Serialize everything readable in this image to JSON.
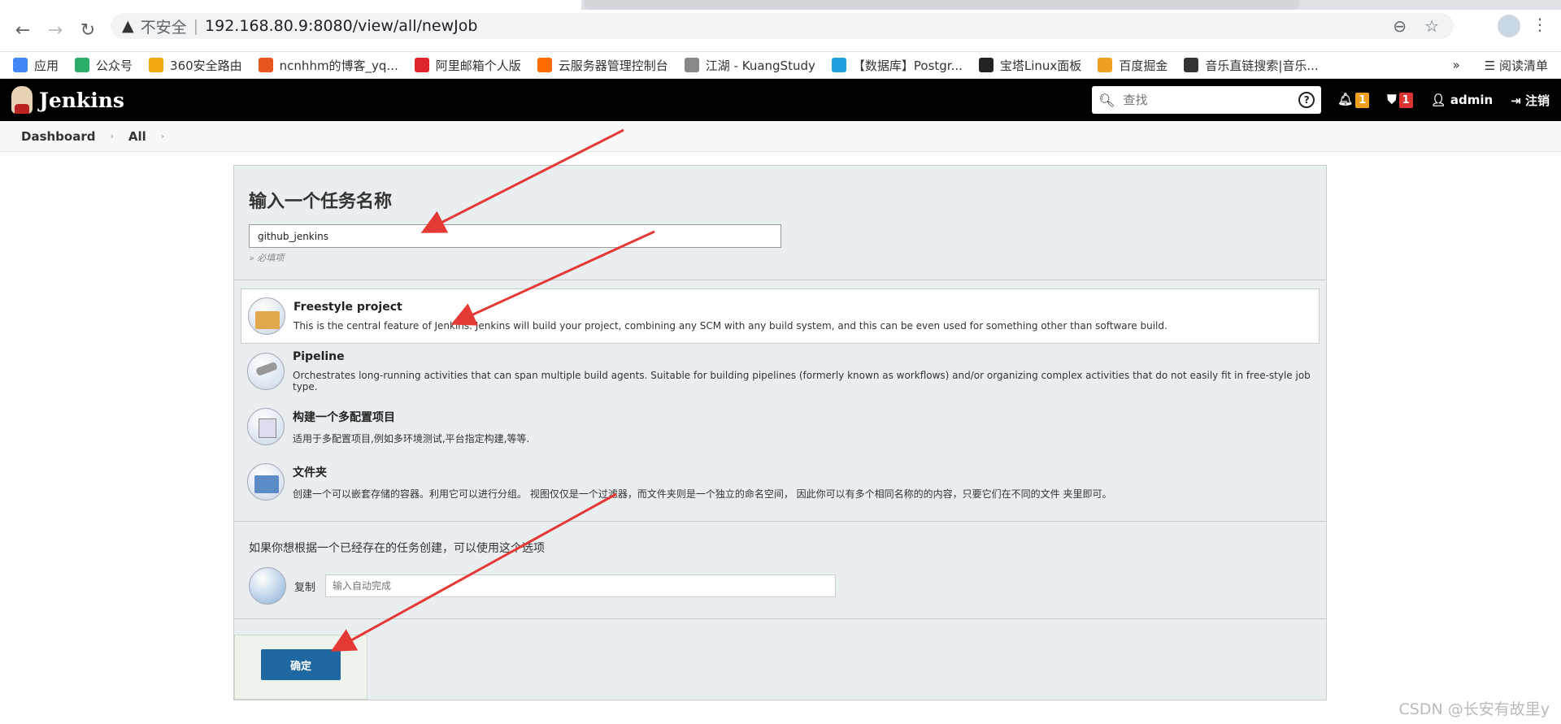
{
  "browser": {
    "insecure_label": "不安全",
    "url": "192.168.80.9:8080/view/all/newJob"
  },
  "bookmarks": [
    {
      "label": "应用",
      "color": "#4285f4"
    },
    {
      "label": "公众号",
      "color": "#2aae67"
    },
    {
      "label": "360安全路由",
      "color": "#f3a712"
    },
    {
      "label": "ncnhhm的博客_yq...",
      "color": "#e8541e"
    },
    {
      "label": "阿里邮箱个人版",
      "color": "#e0242c"
    },
    {
      "label": "云服务器管理控制台",
      "color": "#ff6a00"
    },
    {
      "label": "江湖 - KuangStudy",
      "color": "#888888"
    },
    {
      "label": "【数据库】Postgr...",
      "color": "#20a0e0"
    },
    {
      "label": "宝塔Linux面板",
      "color": "#222222"
    },
    {
      "label": "百度掘金",
      "color": "#f0a020"
    },
    {
      "label": "音乐直链搜索|音乐...",
      "color": "#333333"
    }
  ],
  "bookmarks_more": "»",
  "reading_list": "阅读清单",
  "jenkins": {
    "title": "Jenkins",
    "search_placeholder": "查找",
    "notification_count": "1",
    "security_count": "1",
    "user": "admin",
    "logout": "注销"
  },
  "breadcrumb": [
    "Dashboard",
    "All"
  ],
  "form": {
    "heading": "输入一个任务名称",
    "job_name": "github_jenkins",
    "required_hint": "» 必填项",
    "copy_hint": "如果你想根据一个已经存在的任务创建，可以使用这个选项",
    "copy_label": "复制",
    "copy_placeholder": "输入自动完成",
    "ok_label": "确定"
  },
  "job_types": [
    {
      "title": "Freestyle project",
      "desc": "This is the central feature of Jenkins. Jenkins will build your project, combining any SCM with any build system, and this can be even used for something other than software build.",
      "icon": "freestyle-icon",
      "selected": true
    },
    {
      "title": "Pipeline",
      "desc": "Orchestrates long-running activities that can span multiple build agents. Suitable for building pipelines (formerly known as workflows) and/or organizing complex activities that do not easily fit in free-style job type.",
      "icon": "pipeline-icon",
      "selected": false
    },
    {
      "title": "构建一个多配置项目",
      "desc": "适用于多配置项目,例如多环境测试,平台指定构建,等等.",
      "icon": "multiconfig-icon",
      "selected": false
    },
    {
      "title": "文件夹",
      "desc": "创建一个可以嵌套存储的容器。利用它可以进行分组。 视图仅仅是一个过滤器，而文件夹则是一个独立的命名空间， 因此你可以有多个相同名称的的内容，只要它们在不同的文件 夹里即可。",
      "icon": "folder-icon",
      "selected": false
    }
  ],
  "watermark": "CSDN @长安有故里y",
  "colors": {
    "jenkins_header": "#000000",
    "ok_button": "#1f67a1",
    "arrow": "#e53935"
  }
}
